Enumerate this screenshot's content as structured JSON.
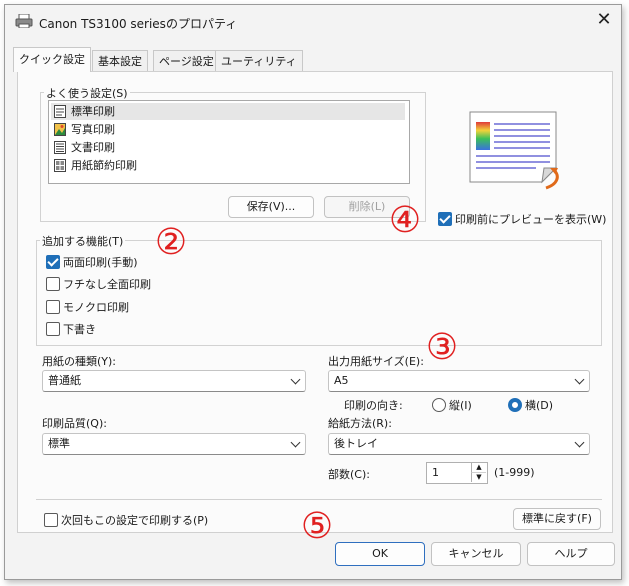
{
  "window": {
    "title": "Canon TS3100 seriesのプロパティ"
  },
  "tabs": [
    "クイック設定",
    "基本設定",
    "ページ設定",
    "ユーティリティ"
  ],
  "presets": {
    "label": "よく使う設定(S)",
    "items": [
      "標準印刷",
      "写真印刷",
      "文書印刷",
      "用紙節約印刷"
    ],
    "save_label": "保存(V)...",
    "delete_label": "削除(L)"
  },
  "preview": {
    "label": "印刷前にプレビューを表示(W)",
    "checked": true
  },
  "features": {
    "label": "追加する機能(T)",
    "items": [
      {
        "label": "両面印刷(手動)",
        "checked": true
      },
      {
        "label": "フチなし全面印刷",
        "checked": false
      },
      {
        "label": "モノクロ印刷",
        "checked": false
      },
      {
        "label": "下書き",
        "checked": false
      }
    ]
  },
  "media_type": {
    "label": "用紙の種類(Y):",
    "value": "普通紙"
  },
  "print_quality": {
    "label": "印刷品質(Q):",
    "value": "標準"
  },
  "output_size": {
    "label": "出力用紙サイズ(E):",
    "value": "A5"
  },
  "orientation": {
    "label": "印刷の向き:",
    "portrait": "縦(I)",
    "landscape": "横(D)",
    "selected": "landscape"
  },
  "paper_source": {
    "label": "給紙方法(R):",
    "value": "後トレイ"
  },
  "copies": {
    "label": "部数(C):",
    "value": "1",
    "range": "(1-999)"
  },
  "always_print": {
    "label": "次回もこの設定で印刷する(P)",
    "checked": false
  },
  "defaults_label": "標準に戻す(F)",
  "footer": {
    "ok": "OK",
    "cancel": "キャンセル",
    "help": "ヘルプ"
  },
  "annotations": [
    "②",
    "③",
    "④",
    "⑤"
  ],
  "colors": {
    "accent": "#1f6fb8",
    "annotation": "#e02020"
  },
  "icons": [
    "printer-icon",
    "close-icon",
    "standard-print-icon",
    "photo-print-icon",
    "document-print-icon",
    "paper-saving-icon",
    "page-preview-icon"
  ]
}
